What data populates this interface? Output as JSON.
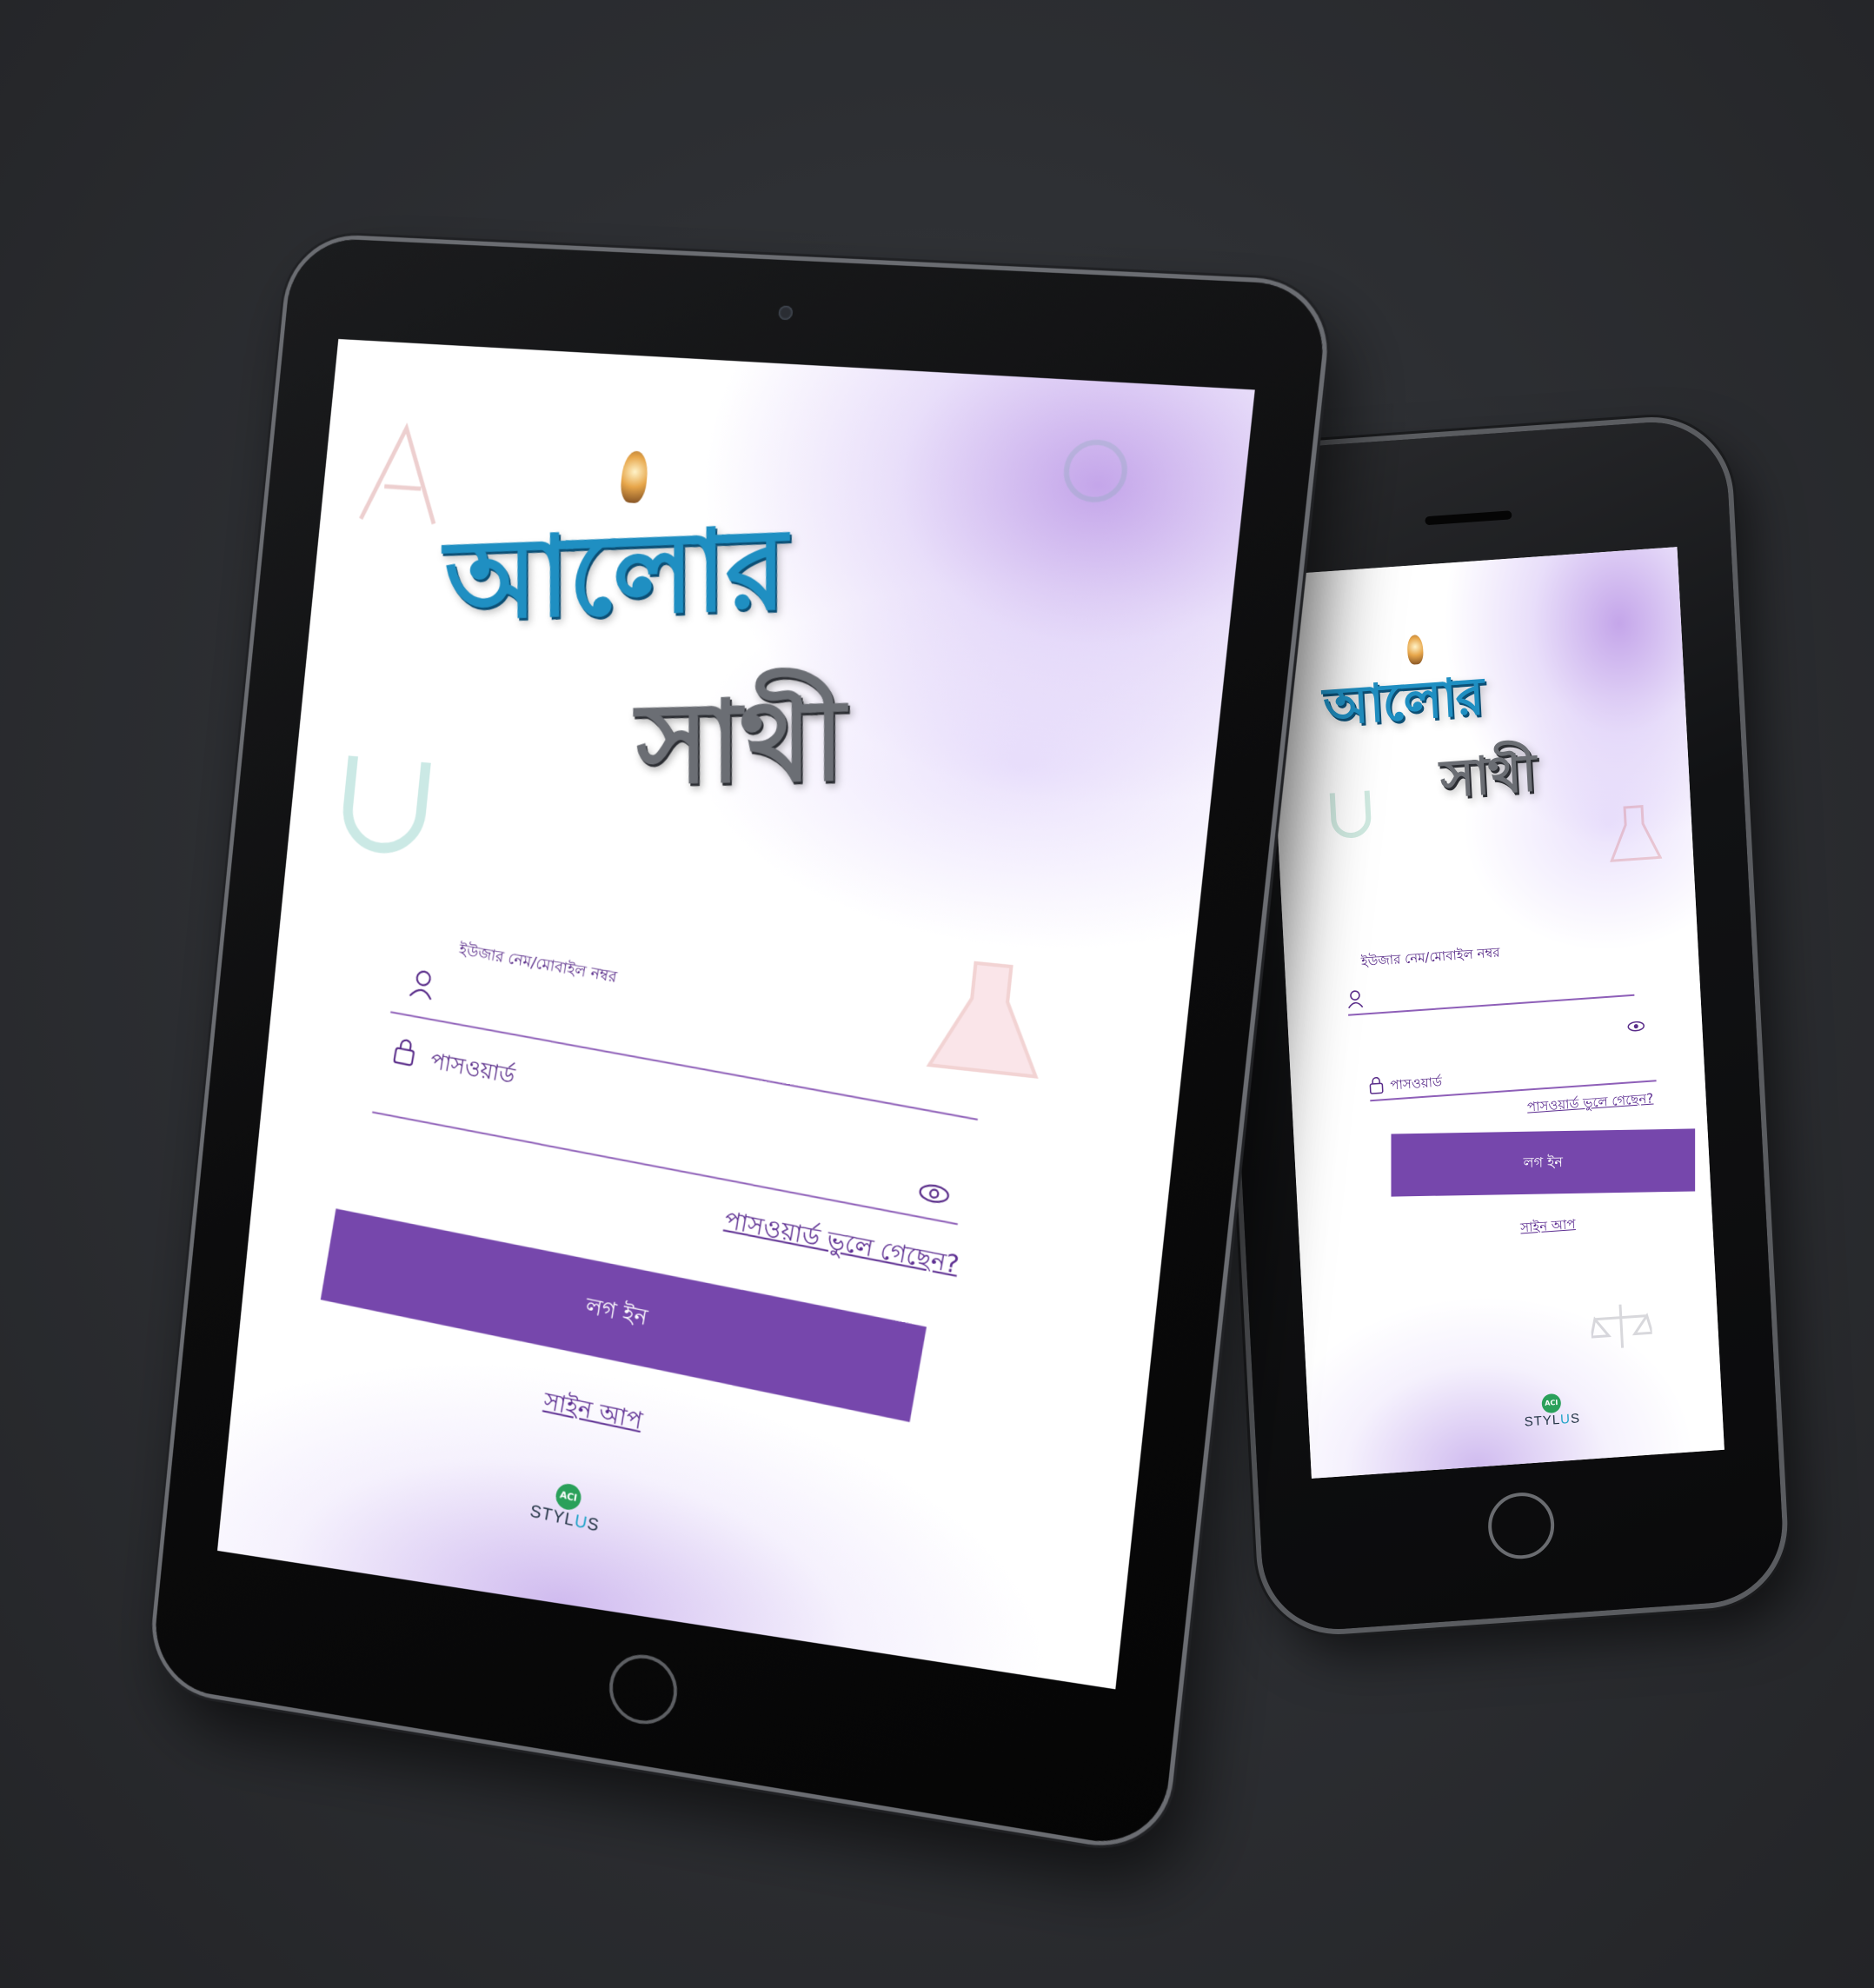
{
  "app": {
    "logo_line1": "আলোর",
    "logo_line2": "সাথী",
    "username_label": "ইউজার নেম/মোবাইল নম্বর",
    "password_placeholder": "পাসওয়ার্ড",
    "forgot_password": "পাসওয়ার্ড ভুলে গেছেন?",
    "login_button": "লগ ইন",
    "signup_link": "সাইন আপ",
    "brand_badge": "ACI",
    "brand_name_a": "STYL",
    "brand_name_b": "U",
    "brand_name_c": "S"
  },
  "icons": {
    "user": "user-icon",
    "lock": "lock-icon",
    "eye": "eye-icon"
  },
  "colors": {
    "primary": "#7647ac",
    "text_purple": "#5a2d8a",
    "logo_blue": "#1f8fc2",
    "logo_gray": "#6b6e74",
    "background": "#2e3034"
  }
}
